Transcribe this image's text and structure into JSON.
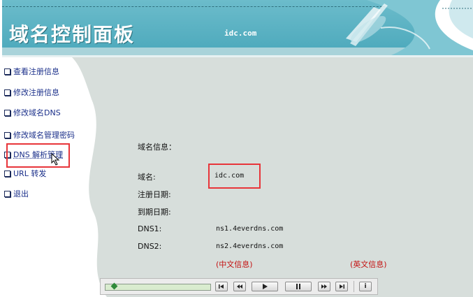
{
  "header": {
    "title": "域名控制面板",
    "domain": "idc.com"
  },
  "sidebar": {
    "items": [
      {
        "label": "查看注册信息",
        "name": "sidebar-item-view-registration"
      },
      {
        "label": "修改注册信息",
        "name": "sidebar-item-edit-registration"
      },
      {
        "label": "修改域名DNS",
        "name": "sidebar-item-edit-dns"
      },
      {
        "label": "修改域名管理密码",
        "name": "sidebar-item-change-password"
      },
      {
        "label": "DNS 解析管理",
        "name": "sidebar-item-dns-resolution"
      },
      {
        "label": "URL 转发",
        "name": "sidebar-item-url-forwarding"
      },
      {
        "label": "退出",
        "name": "sidebar-item-logout"
      }
    ]
  },
  "domain_info": {
    "heading": "域名信息：",
    "domain_label": "域名:",
    "domain_value": "idc.com",
    "reg_date_label": "注册日期:",
    "expire_date_label": "到期日期:",
    "dns1_label": "DNS1:",
    "dns1_value": "ns1.4everdns.com",
    "dns2_label": "DNS2:",
    "dns2_value": "ns2.4everdns.com",
    "cn_info_link": "(中文信息)",
    "en_info_link": "(英文信息)"
  },
  "player": {
    "progress": 0.05,
    "buttons": [
      "skip-back-icon",
      "rewind-icon",
      "play-icon",
      "pause-icon",
      "fast-forward-icon",
      "skip-forward-icon",
      "info-icon"
    ],
    "info_label": "i"
  },
  "colors": {
    "header_teal": "#4ba8bb",
    "panel_gray": "#d7dedb",
    "nav_link": "#1a2f8a",
    "highlight_red": "#e8353a",
    "link_red": "#c41212"
  }
}
